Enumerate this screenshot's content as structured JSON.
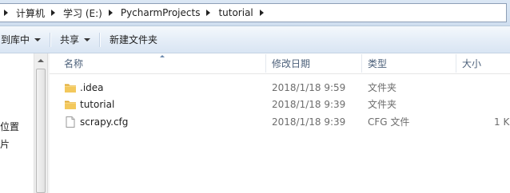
{
  "address_bar": {
    "crumbs": [
      "计算机",
      "学习 (E:)",
      "PycharmProjects",
      "tutorial"
    ]
  },
  "toolbar": {
    "include_in_library": "到库中",
    "share": "共享",
    "new_folder": "新建文件夹"
  },
  "nav_pane": {
    "item_location": "位置",
    "item_partial": "片"
  },
  "columns": {
    "name": "名称",
    "date_modified": "修改日期",
    "type": "类型",
    "size": "大小"
  },
  "files": [
    {
      "name": ".idea",
      "date": "2018/1/18 9:59",
      "type": "文件夹",
      "size": "",
      "icon": "folder-icon"
    },
    {
      "name": "tutorial",
      "date": "2018/1/18 9:39",
      "type": "文件夹",
      "size": "",
      "icon": "folder-icon"
    },
    {
      "name": "scrapy.cfg",
      "date": "2018/1/18 9:39",
      "type": "CFG 文件",
      "size": "1 K",
      "icon": "file-icon"
    }
  ],
  "colors": {
    "folder": "#e8b64a",
    "header_text": "#4c607a",
    "toolbar_bg": "#dde8f5"
  }
}
